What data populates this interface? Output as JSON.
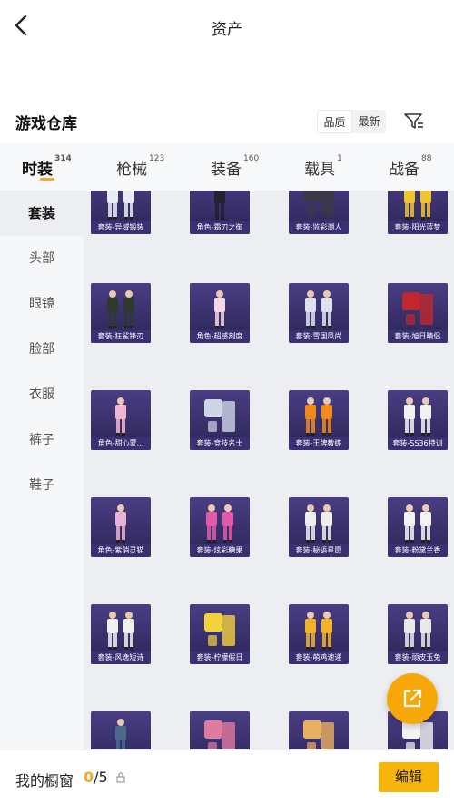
{
  "header": {
    "title": "资产",
    "back_icon": "chevron-left-icon"
  },
  "warehouse": {
    "title": "游戏仓库",
    "sort_options": [
      "品质",
      "最新"
    ],
    "filter_icon": "filter-icon"
  },
  "tabs": [
    {
      "label": "时装",
      "count": "314"
    },
    {
      "label": "枪械",
      "count": "123"
    },
    {
      "label": "装备",
      "count": "160"
    },
    {
      "label": "载具",
      "count": "1"
    },
    {
      "label": "战备",
      "count": "88"
    }
  ],
  "sidebar": {
    "items": [
      {
        "label": "套装"
      },
      {
        "label": "头部"
      },
      {
        "label": "眼镜"
      },
      {
        "label": "脸部"
      },
      {
        "label": "衣服"
      },
      {
        "label": "裤子"
      },
      {
        "label": "鞋子"
      }
    ]
  },
  "items": [
    {
      "label": "套装-异域锻装",
      "kind": "pair",
      "color": "#e8ecf4"
    },
    {
      "label": "角色-霜刃之御",
      "kind": "single",
      "color": "#222233"
    },
    {
      "label": "套装-监彩潮人",
      "kind": "outfit",
      "color": "#3a3a44"
    },
    {
      "label": "套装-阳光蓝梦",
      "kind": "pair",
      "color": "#f1c232"
    },
    {
      "label": "套装-狂鲨锋刃",
      "kind": "pair",
      "color": "#2f3a2f"
    },
    {
      "label": "角色-超感刻度",
      "kind": "single",
      "color": "#f4d6e6"
    },
    {
      "label": "套装-雪国风尚",
      "kind": "pair",
      "color": "#dde3ee"
    },
    {
      "label": "套装-旭日晴侣",
      "kind": "outfit",
      "color": "#c0282d"
    },
    {
      "label": "角色-甜心蒙...",
      "kind": "single",
      "color": "#f3b6d2"
    },
    {
      "label": "套装-竞技名士",
      "kind": "outfit",
      "color": "#cdd6e6"
    },
    {
      "label": "套装-王牌教练",
      "kind": "pair",
      "color": "#f08a1c"
    },
    {
      "label": "套装-SS36特训",
      "kind": "pair",
      "color": "#f2f2f2"
    },
    {
      "label": "角色-紫俏灵猫",
      "kind": "single",
      "color": "#e8b3d6"
    },
    {
      "label": "套装-炫彩糖果",
      "kind": "pair",
      "color": "#e05aa8"
    },
    {
      "label": "套装-秘语星愿",
      "kind": "pair",
      "color": "#eeeeee"
    },
    {
      "label": "套装-粉黛兰香",
      "kind": "pair",
      "color": "#f4f4f4"
    },
    {
      "label": "套装-风逸短诗",
      "kind": "pair",
      "color": "#f0f0f0"
    },
    {
      "label": "套装-柠檬假日",
      "kind": "outfit",
      "color": "#f3d23a"
    },
    {
      "label": "套装-萌鸡速递",
      "kind": "pair",
      "color": "#f2b42a"
    },
    {
      "label": "套装-顽皮玉兔",
      "kind": "pair",
      "color": "#e9e9e9"
    },
    {
      "label": "",
      "kind": "single",
      "color": "#4a6a8c"
    },
    {
      "label": "",
      "kind": "outfit",
      "color": "#e07aa0"
    },
    {
      "label": "",
      "kind": "outfit",
      "color": "#e8b060"
    },
    {
      "label": "",
      "kind": "outfit",
      "color": "#f4f4f4"
    }
  ],
  "fab": {
    "icon": "share-external-icon"
  },
  "bottom": {
    "showcase_label": "我的橱窗",
    "current": "0",
    "separator": "/",
    "total": "5",
    "lock_icon": "lock-icon",
    "edit_label": "编辑"
  }
}
